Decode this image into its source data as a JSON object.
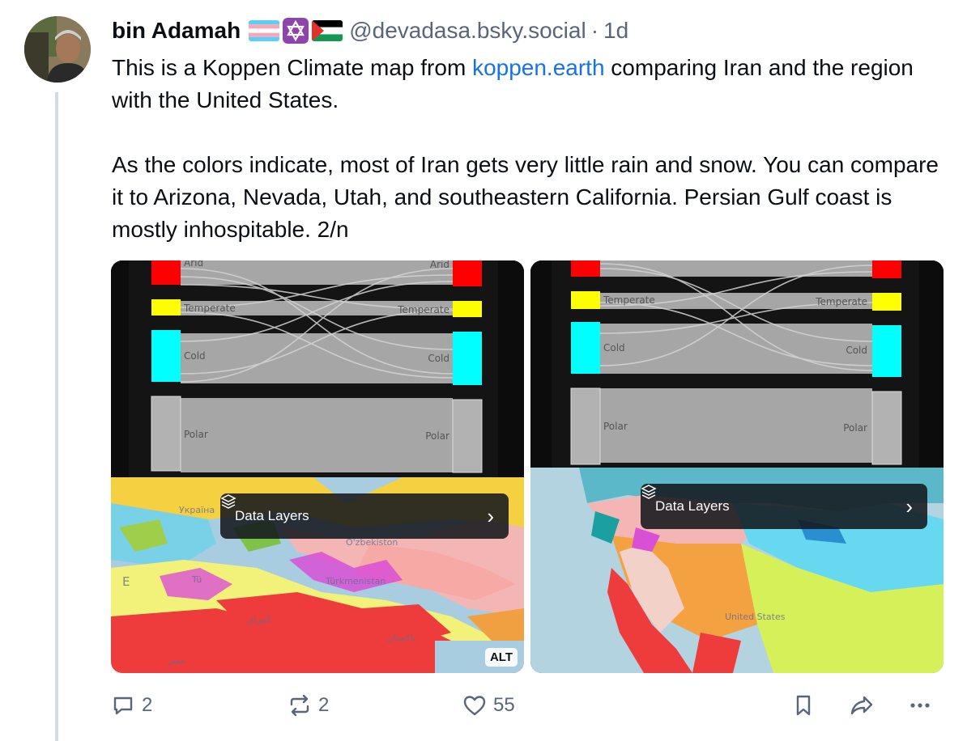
{
  "post": {
    "author_name": "bin Adamah",
    "handle": "@devadasa.bsky.social",
    "separator": "·",
    "time": "1d",
    "text_before_link": "This is a Koppen Climate map from ",
    "link_text": "koppen.earth",
    "text_after_link": " comparing Iran and the region with the United States.",
    "paragraph_2": "As the colors indicate, most of Iran gets very little rain and snow. You can compare it to Arizona, Nevada, Utah, and  southeastern California. Persian Gulf coast is mostly inhospitable. 2/n"
  },
  "images": {
    "left": {
      "sankey_labels": {
        "arid": "Arid",
        "arid_right": "Arid",
        "temperate": "Temperate",
        "temperate_right": "Temperate",
        "cold": "Cold",
        "cold_right": "Cold",
        "polar": "Polar",
        "polar_right": "Polar"
      },
      "map_labels": {
        "ukraine": "Україна",
        "uzbekistan": "O'zbekiston",
        "turkmenistan": "Türkmenistan",
        "iraq": "العراق",
        "pakistan": "پاکستان",
        "egypt": "مصر",
        "turkey": "Tü",
        "edge": "E"
      },
      "data_layers_label": "Data Layers",
      "alt_badge": "ALT"
    },
    "right": {
      "sankey_labels": {
        "temperate": "Temperate",
        "temperate_right": "Temperate",
        "cold": "Cold",
        "cold_right": "Cold",
        "polar": "Polar",
        "polar_right": "Polar"
      },
      "map_labels": {
        "us": "United States"
      },
      "data_layers_label": "Data Layers"
    }
  },
  "actions": {
    "reply_count": "2",
    "repost_count": "2",
    "like_count": "55"
  },
  "icons": [
    "avatar",
    "trans-flag-icon",
    "star-of-david-icon",
    "palestine-flag-icon",
    "layers-icon",
    "chevron-right-icon",
    "reply-icon",
    "repost-icon",
    "like-icon",
    "bookmark-icon",
    "share-icon",
    "more-icon"
  ],
  "colors": {
    "link": "#1673e6",
    "muted": "#59667a",
    "arid": "#ff0000",
    "temperate": "#ffff00",
    "cold": "#00ffff",
    "polar": "#b2b2b2"
  }
}
